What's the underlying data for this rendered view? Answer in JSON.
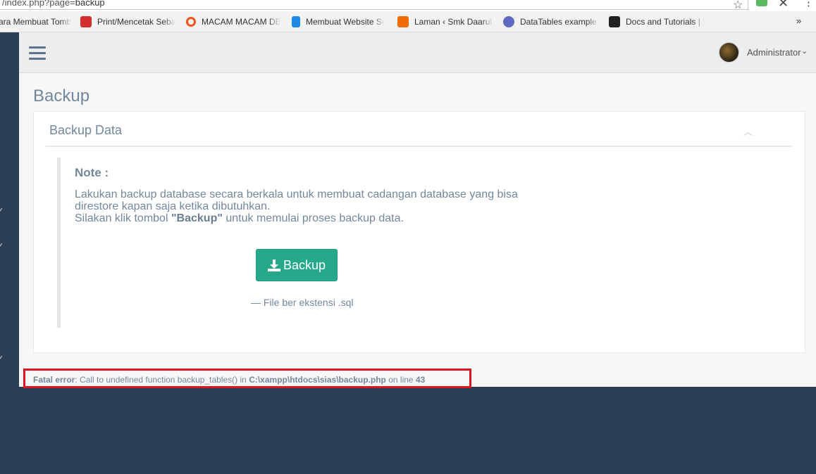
{
  "browser": {
    "url_prefix": "/index.php?page=",
    "url_path": "backup",
    "bookmarks": [
      {
        "label": "ara Membuat Tomb",
        "color": "transparent"
      },
      {
        "label": "Print/Mencetak Seba",
        "color": "#d32f2f"
      },
      {
        "label": "MACAM MACAM DB",
        "color": "#f4511e"
      },
      {
        "label": "Membuat Website Se",
        "color": "#1e88e5"
      },
      {
        "label": "Laman ‹ Smk Daarul A",
        "color": "#ef6c00"
      },
      {
        "label": "DataTables example -",
        "color": "#5c6bc0"
      },
      {
        "label": "Docs and Tutorials | M",
        "color": "#212121"
      }
    ],
    "more": "»"
  },
  "nav": {
    "user_name": "Administrator"
  },
  "page": {
    "title": "Backup",
    "panel_title": "Backup Data",
    "note_title": "Note :",
    "note_line1": "Lakukan backup database secara berkala untuk membuat cadangan database yang bisa direstore kapan saja ketika dibutuhkan.",
    "note_line2_pre": "Silakan klik tombol ",
    "note_line2_bold": "\"Backup\"",
    "note_line2_post": " untuk memulai proses backup data.",
    "backup_button": "Backup",
    "file_note": "— File ber ekstensi .sql"
  },
  "error": {
    "label": "Fatal error",
    "message": ": Call to undefined function backup_tables() in ",
    "file": "C:\\xampp\\htdocs\\sias\\backup.php",
    "on_line": " on line ",
    "line": "43"
  }
}
